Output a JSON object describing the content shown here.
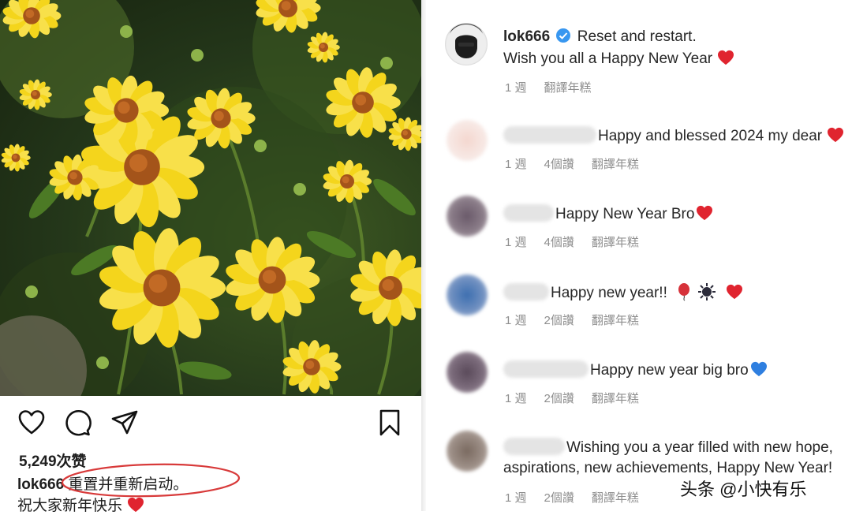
{
  "post": {
    "likes": "5,249次赞",
    "username": "lok666",
    "caption_cn": " 重置并重新启动。",
    "caption_cn_line2": "祝大家新年快乐"
  },
  "thread": {
    "author": {
      "username": "lok666",
      "text_line1": "Reset and restart.",
      "text_line2": "Wish you all a Happy New Year",
      "time": "1 週",
      "translate": "翻譯年糕"
    },
    "comments": [
      {
        "text": "Happy and blessed 2024 my dear",
        "time": "1 週",
        "likes": "4個讚",
        "translate": "翻譯年糕"
      },
      {
        "text": "Happy New Year Bro",
        "time": "1 週",
        "likes": "4個讚",
        "translate": "翻譯年糕"
      },
      {
        "text": "Happy new year!!",
        "time": "1 週",
        "likes": "2個讚",
        "translate": "翻譯年糕"
      },
      {
        "text": "Happy new year big bro",
        "time": "1 週",
        "likes": "2個讚",
        "translate": "翻譯年糕"
      },
      {
        "text": "Wishing you a year filled with new hope,",
        "text_line2": "aspirations, new achievements, Happy New Year!",
        "time": "1 週",
        "likes": "2個讚",
        "translate": "翻譯年糕"
      }
    ]
  },
  "watermark": "头条 @小快有乐",
  "colors": {
    "heart_red": "#e0242f",
    "heart_blue": "#2f7fe0",
    "verified_blue": "#3897f0",
    "ellipse_red": "#d83a3a"
  },
  "icons": [
    "heart-icon",
    "comment-icon",
    "share-icon",
    "bookmark-icon",
    "verified-badge-icon",
    "red-heart-icon",
    "blue-heart-icon",
    "balloon-icon",
    "firework-icon"
  ]
}
